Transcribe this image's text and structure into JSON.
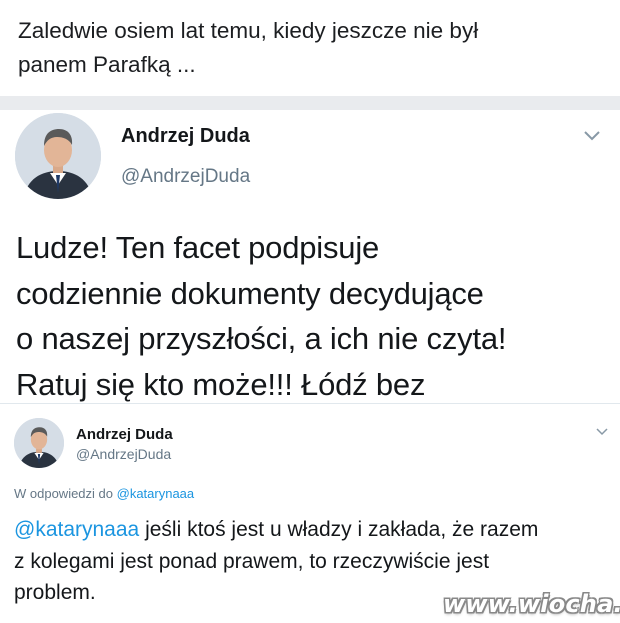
{
  "caption": {
    "line1": "Zaledwie osiem lat temu, kiedy jeszcze nie był",
    "line2": "panem Parafką ..."
  },
  "tweet1": {
    "author_name": "Andrzej Duda",
    "author_handle": "@AndrzejDuda",
    "avatar_icon": "profile-photo",
    "menu_icon": "chevron-down-icon",
    "text_lines": [
      "Ludze! Ten facet podpisuje",
      "codziennie dokumenty decydujące",
      "o naszej przyszłości, a ich nie czyta!",
      "Ratuj się kto może!!! Łódź bez"
    ]
  },
  "tweet2": {
    "author_name": "Andrzej Duda",
    "author_handle": "@AndrzejDuda",
    "avatar_icon": "profile-photo",
    "menu_icon": "chevron-down-icon",
    "reply_prefix": "W odpowiedzi do",
    "reply_to": "@katarynaaa",
    "mention": "@katarynaaa",
    "text_line1_rest": " jeśli ktoś jest u władzy i zakłada, że razem",
    "text_line2": "z kolegami jest ponad prawem, to rzeczywiście jest",
    "text_line3": "problem."
  },
  "watermark": "www.wiocha.pl",
  "colors": {
    "link": "#1b95e0",
    "secondary_text": "#657786",
    "band": "#e9ebee"
  }
}
